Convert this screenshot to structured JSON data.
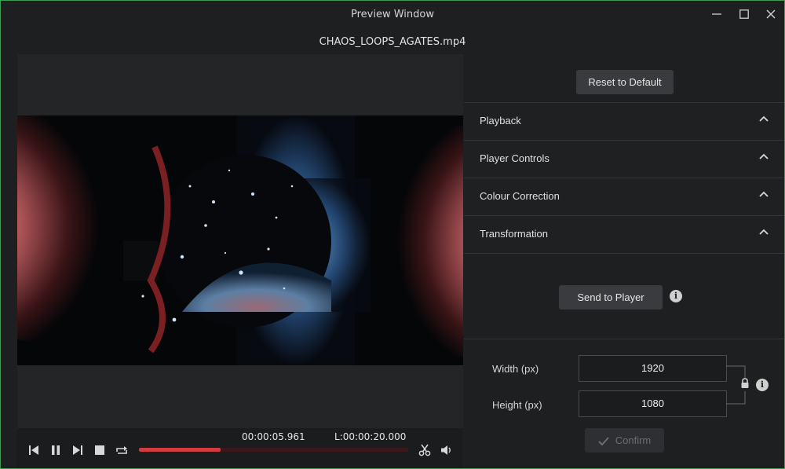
{
  "window": {
    "title": "Preview Window"
  },
  "file": {
    "name": "CHAOS_LOOPS_AGATES.mp4"
  },
  "player": {
    "current_time": "00:00:05.961",
    "length": "L:00:00:20.000",
    "progress_percent": 30.3
  },
  "settings": {
    "reset_label": "Reset to Default",
    "sections": [
      {
        "label": "Playback"
      },
      {
        "label": "Player Controls"
      },
      {
        "label": "Colour Correction"
      },
      {
        "label": "Transformation"
      }
    ],
    "send_label": "Send to Player",
    "width_label": "Width (px)",
    "width_value": "1920",
    "height_label": "Height (px)",
    "height_value": "1080",
    "confirm_label": "Confirm"
  },
  "colors": {
    "accent_red": "#d23c3f",
    "window_border": "#3b9b52",
    "background": "#1e1f21"
  },
  "icons": [
    "minimize-icon",
    "maximize-icon",
    "close-icon",
    "skip-back-icon",
    "pause-icon",
    "skip-forward-icon",
    "stop-icon",
    "loop-icon",
    "scissors-icon",
    "volume-icon",
    "chevron-up-icon",
    "info-icon",
    "lock-icon",
    "check-icon"
  ]
}
